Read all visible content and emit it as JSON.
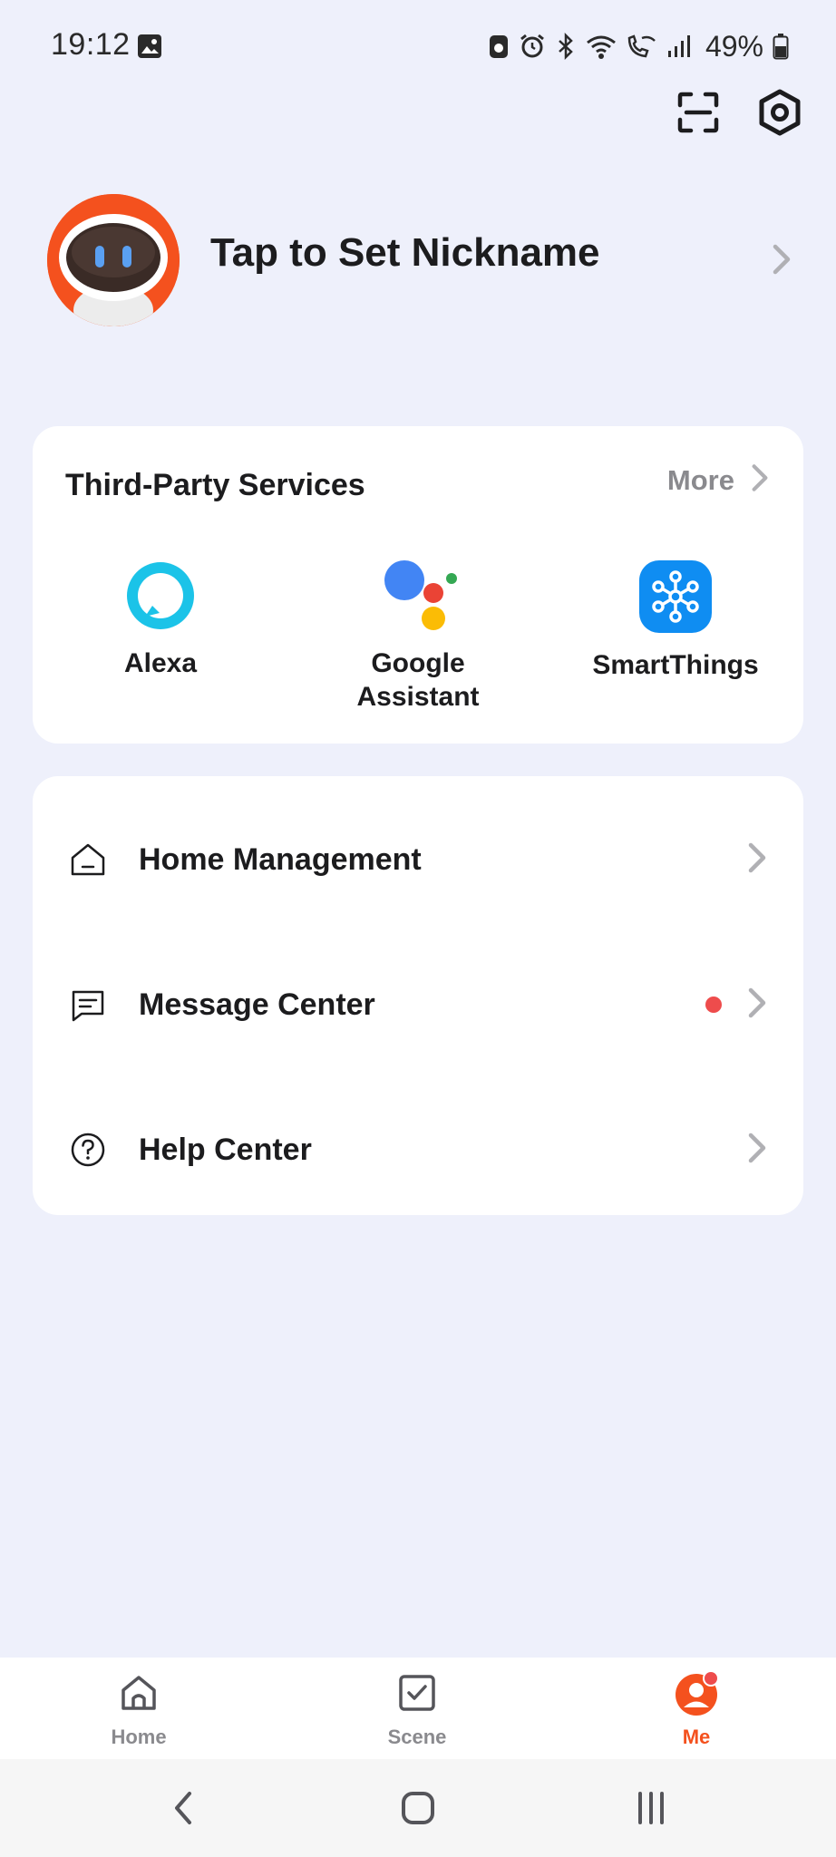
{
  "status_bar": {
    "time": "19:12",
    "battery": "49%"
  },
  "header": {
    "scan_icon": "scan-icon",
    "settings_icon": "settings-hexagon-icon"
  },
  "profile": {
    "nickname": "Tap to Set Nickname"
  },
  "third_party": {
    "title": "Third-Party Services",
    "more_label": "More",
    "services": [
      {
        "label": "Alexa",
        "icon": "alexa-icon"
      },
      {
        "label": "Google Assistant",
        "icon": "google-assistant-icon"
      },
      {
        "label": "SmartThings",
        "icon": "smartthings-icon"
      }
    ]
  },
  "menu": {
    "items": [
      {
        "label": "Home Management",
        "icon": "house-icon",
        "badge": false
      },
      {
        "label": "Message Center",
        "icon": "message-icon",
        "badge": true
      },
      {
        "label": "Help Center",
        "icon": "help-icon",
        "badge": false
      }
    ]
  },
  "tabs": [
    {
      "label": "Home",
      "icon": "home-icon",
      "active": false
    },
    {
      "label": "Scene",
      "icon": "scene-checkbox-icon",
      "active": false
    },
    {
      "label": "Me",
      "icon": "me-icon",
      "active": true
    }
  ],
  "colors": {
    "accent": "#f4511e",
    "background": "#eef0fb",
    "badge": "#ee4c4c"
  }
}
